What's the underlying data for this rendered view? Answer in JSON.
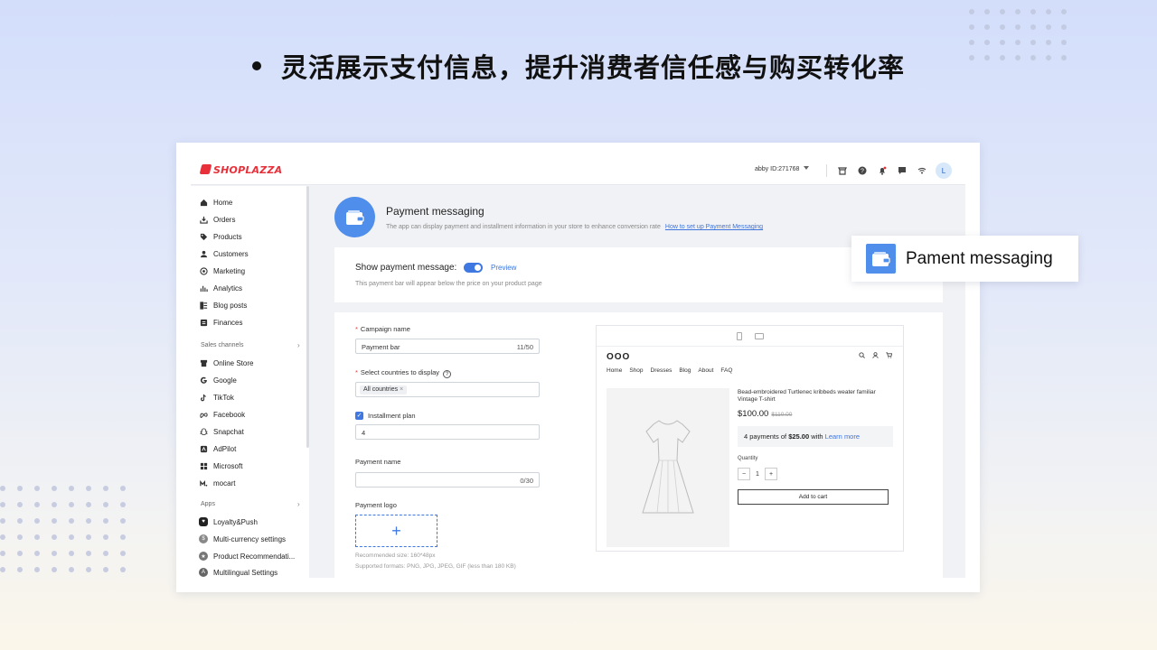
{
  "headline": "灵活展示支付信息，提升消费者信任感与购买转化率",
  "app": {
    "logo_text": "SHOPLAZZA",
    "account_label": "abby",
    "account_id": "ID:271768",
    "avatar_initial": "L",
    "brand_color": "#e8303a",
    "accent_color": "#3f78e0"
  },
  "sidebar": {
    "items": [
      {
        "label": "Home",
        "icon": "home-icon"
      },
      {
        "label": "Orders",
        "icon": "download-icon"
      },
      {
        "label": "Products",
        "icon": "tag-icon"
      },
      {
        "label": "Customers",
        "icon": "user-icon"
      },
      {
        "label": "Marketing",
        "icon": "target-icon"
      },
      {
        "label": "Analytics",
        "icon": "bar-chart-icon"
      },
      {
        "label": "Blog posts",
        "icon": "blog-icon"
      },
      {
        "label": "Finances",
        "icon": "finance-icon"
      }
    ],
    "sales_channels_title": "Sales channels",
    "sales_channels": [
      {
        "label": "Online Store",
        "icon": "store-icon"
      },
      {
        "label": "Google",
        "icon": "google-icon"
      },
      {
        "label": "TikTok",
        "icon": "tiktok-icon"
      },
      {
        "label": "Facebook",
        "icon": "meta-icon"
      },
      {
        "label": "Snapchat",
        "icon": "snapchat-icon"
      },
      {
        "label": "AdPilot",
        "icon": "adpilot-icon"
      },
      {
        "label": "Microsoft",
        "icon": "microsoft-icon"
      },
      {
        "label": "mocart",
        "icon": "mocart-icon"
      }
    ],
    "apps_title": "Apps",
    "apps": [
      {
        "label": "Loyalty&Push",
        "icon": "loyalty-app-icon"
      },
      {
        "label": "Multi-currency settings",
        "icon": "currency-app-icon"
      },
      {
        "label": "Product Recommendati...",
        "icon": "recommendation-app-icon"
      },
      {
        "label": "Multilingual Settings",
        "icon": "language-app-icon"
      }
    ]
  },
  "page": {
    "title": "Payment messaging",
    "description": "The app can display payment and installment information in your store to enhance conversion rate",
    "help_link": "How to set up Payment Messaging"
  },
  "show_message": {
    "label": "Show payment message:",
    "enabled": true,
    "preview_link": "Preview",
    "note": "This payment bar will appear below the price on your product page"
  },
  "form": {
    "campaign_label": "Campaign name",
    "campaign_value": "Payment bar",
    "campaign_count": "11/50",
    "countries_label": "Select countries to display",
    "countries_chip": "All countries",
    "installment_label": "Installment plan",
    "installment_checked": true,
    "installment_value": "4",
    "payment_name_label": "Payment name",
    "payment_name_count": "0/30",
    "payment_logo_label": "Payment logo",
    "upload_symbol": "+",
    "hint_size": "Recommended size: 160*48px",
    "hint_formats": "Supported formats: PNG, JPG, JPEG, GIF (less than 180 KB)"
  },
  "preview": {
    "store_logo": "OOO",
    "nav": [
      "Home",
      "Shop",
      "Dresses",
      "Blog",
      "About",
      "FAQ"
    ],
    "product_name": "Bead-embroidered Turtlenec kribbeds weater familiar Vintage T-shirt",
    "price": "$100.00",
    "old_price": "$110.00",
    "pay_prefix": "4 payments of ",
    "pay_amount": "$25.00",
    "pay_mid": " with ",
    "pay_link": "Learn more",
    "qty_label": "Quantity",
    "qty_value": "1",
    "add_to_cart": "Add to cart"
  },
  "callout": {
    "label": "Pament messaging"
  }
}
